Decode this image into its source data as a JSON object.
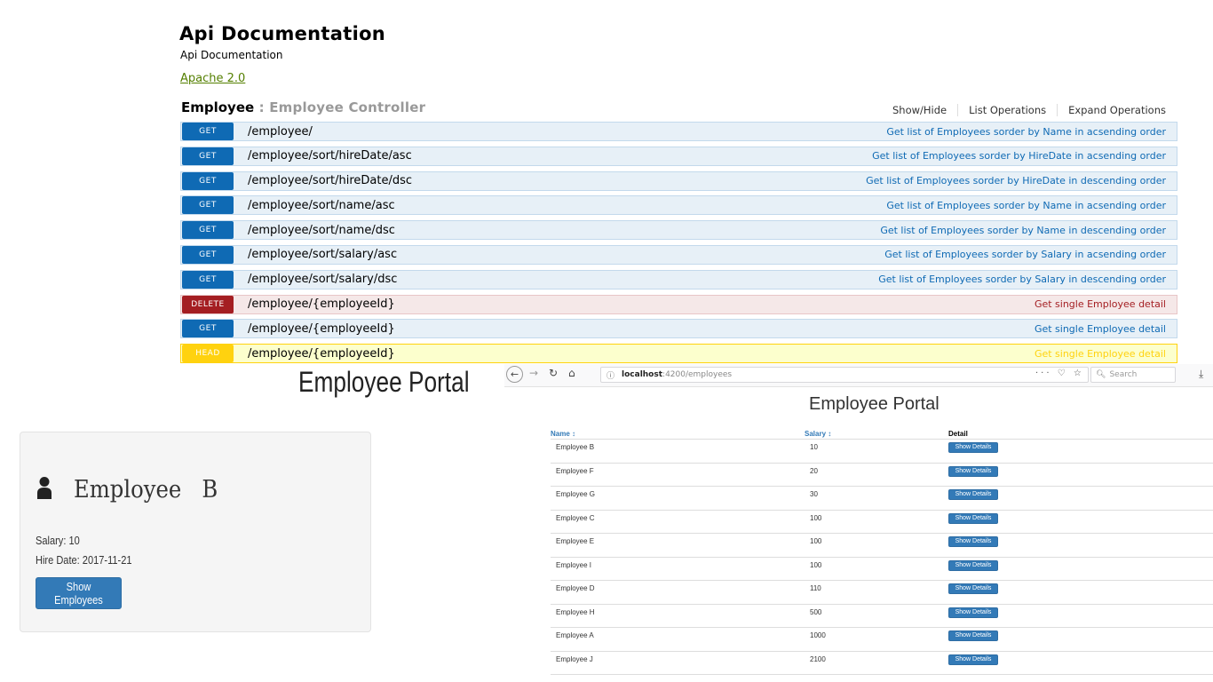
{
  "api": {
    "title": "Api Documentation",
    "subtitle": "Api Documentation",
    "license": "Apache 2.0"
  },
  "controller": {
    "name": "Employee",
    "separator": " : ",
    "description": "Employee Controller",
    "options": [
      "Show/Hide",
      "List Operations",
      "Expand Operations"
    ]
  },
  "operations": [
    {
      "method": "GET",
      "path": "/employee/",
      "summary": "Get list of Employees sorder by Name in acsending order"
    },
    {
      "method": "GET",
      "path": "/employee/sort/hireDate/asc",
      "summary": "Get list of Employees sorder by HireDate in acsending order"
    },
    {
      "method": "GET",
      "path": "/employee/sort/hireDate/dsc",
      "summary": "Get list of Employees sorder by HireDate in descending order"
    },
    {
      "method": "GET",
      "path": "/employee/sort/name/asc",
      "summary": "Get list of Employees sorder by Name in acsending order"
    },
    {
      "method": "GET",
      "path": "/employee/sort/name/dsc",
      "summary": "Get list of Employees sorder by Name in descending order"
    },
    {
      "method": "GET",
      "path": "/employee/sort/salary/asc",
      "summary": "Get list of Employees sorder by Salary in acsending order"
    },
    {
      "method": "GET",
      "path": "/employee/sort/salary/dsc",
      "summary": "Get list of Employees sorder by Salary in descending order"
    },
    {
      "method": "DELETE",
      "path": "/employee/{employeeId}",
      "summary": "Get single Employee detail"
    },
    {
      "method": "GET",
      "path": "/employee/{employeeId}",
      "summary": "Get single Employee detail"
    },
    {
      "method": "HEAD",
      "path": "/employee/{employeeId}",
      "summary": "Get single Employee detail"
    }
  ],
  "portal": {
    "heading": "Employee Portal"
  },
  "employee_card": {
    "icon": "user-icon",
    "name": "Employee   B",
    "salary": "Salary: 10",
    "hire_date": "Hire Date: 2017-11-21",
    "button": "Show Employees"
  },
  "browser": {
    "back_icon": "←",
    "forward_icon": "→",
    "reload_icon": "↻",
    "home_icon": "⌂",
    "info_icon": "ⓘ",
    "url_host": "localhost",
    "url_path": ":4200/employees",
    "page_actions": "··· ♡ ☆",
    "search_icon": "🔍︎",
    "search_placeholder": "Search",
    "download_icon": "⤓"
  },
  "employee_list": {
    "title": "Employee Portal",
    "columns": [
      "Name ↕",
      "Salary ↕",
      "Detail"
    ],
    "button_label": "Show Details",
    "rows": [
      {
        "name": "Employee B",
        "salary": "10"
      },
      {
        "name": "Employee F",
        "salary": "20"
      },
      {
        "name": "Employee G",
        "salary": "30"
      },
      {
        "name": "Employee C",
        "salary": "100"
      },
      {
        "name": "Employee E",
        "salary": "100"
      },
      {
        "name": "Employee I",
        "salary": "100"
      },
      {
        "name": "Employee D",
        "salary": "110"
      },
      {
        "name": "Employee H",
        "salary": "500"
      },
      {
        "name": "Employee A",
        "salary": "1000"
      },
      {
        "name": "Employee J",
        "salary": "2100"
      }
    ]
  },
  "colors": {
    "get": "#0f6ab4",
    "delete": "#a41e22",
    "head": "#ffd20f",
    "license_link": "#547f00",
    "primary_button": "#337ab7"
  }
}
